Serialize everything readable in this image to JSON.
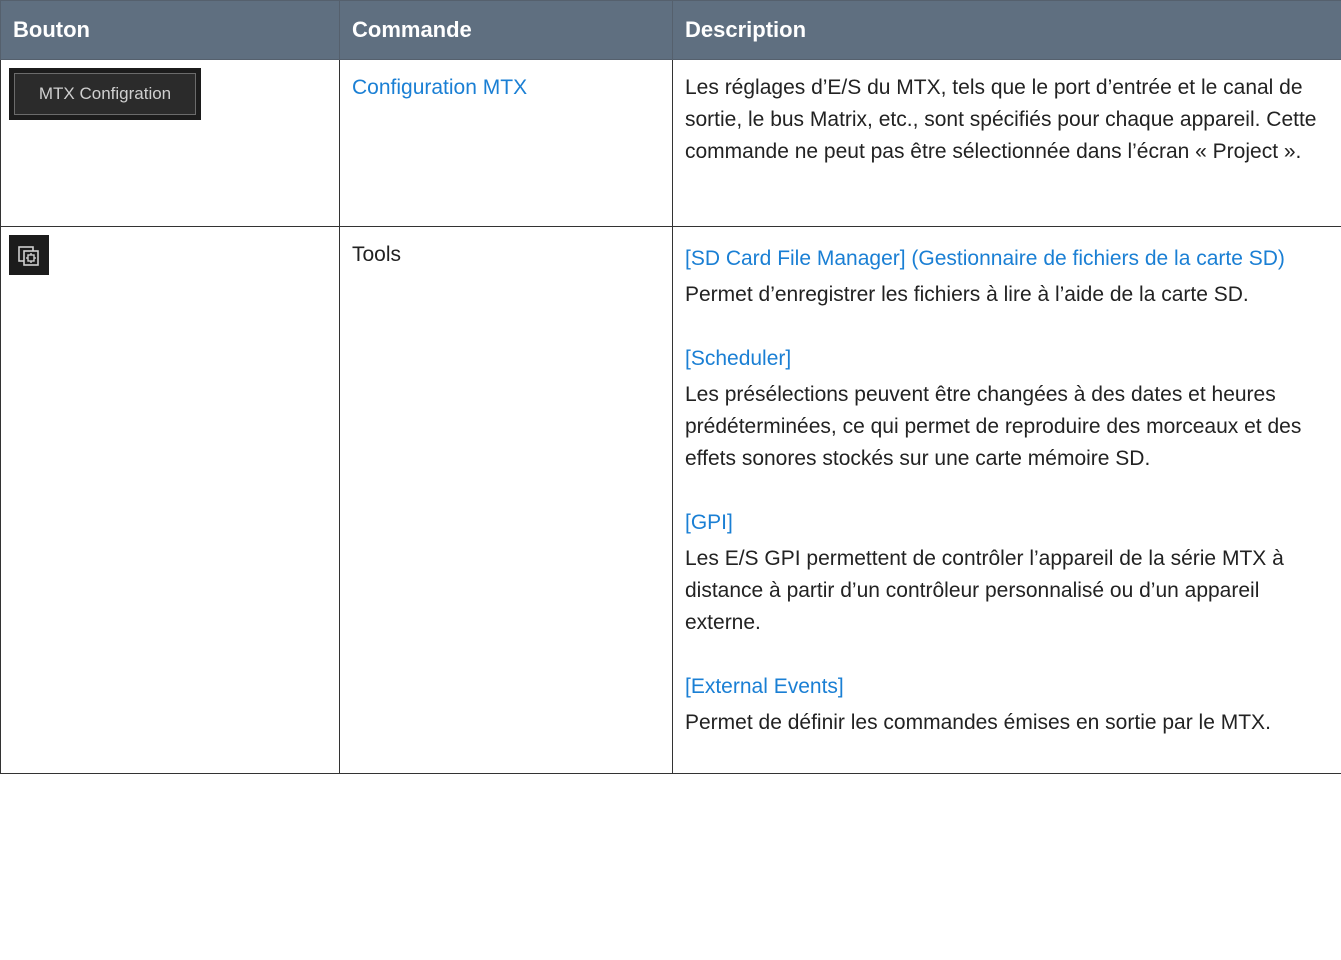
{
  "header": {
    "col_button": "Bouton",
    "col_command": "Commande",
    "col_description": "Description"
  },
  "rows": [
    {
      "button_label": "MTX Configration",
      "command": "Configuration MTX",
      "description": "Les réglages d’E/S du MTX, tels que le port d’entrée et le canal de sortie, le bus Matrix, etc., sont spécifiés pour chaque appareil. Cette commande ne peut pas être sélectionnée dans l’écran « Project »."
    },
    {
      "button_icon": "tools-icon",
      "command": "Tools",
      "sections": [
        {
          "title": "[SD Card File Manager] (Gestionnaire de fichiers de la carte SD)",
          "text": "Permet d’enregistrer les fichiers à lire à l’aide de la carte SD."
        },
        {
          "title": "[Scheduler]",
          "text": "Les présélections peuvent être changées à des dates et heures prédéterminées, ce qui permet de reproduire des morceaux et des effets sonores stockés sur une carte mémoire SD."
        },
        {
          "title": "[GPI]",
          "text": "Les E/S GPI permettent de contrôler l’appareil de la série MTX à distance à partir d’un contrôleur personnalisé ou d’un appareil externe."
        },
        {
          "title": "[External Events]",
          "text": "Permet de définir les commandes émises en sortie par le MTX."
        }
      ]
    }
  ],
  "colors": {
    "header_bg": "#5f6f80",
    "link": "#1a7fd4",
    "button_bg": "#1c1c1c"
  }
}
